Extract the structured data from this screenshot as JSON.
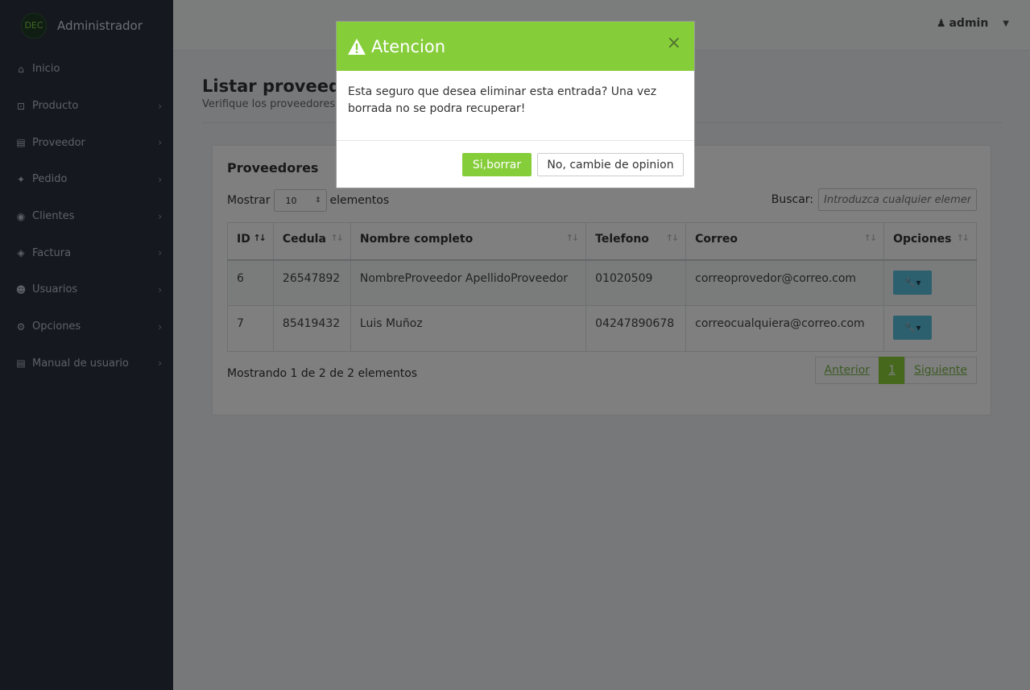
{
  "brand": {
    "logo_text": "DEC",
    "name": "Administrador"
  },
  "sidebar": {
    "items": [
      {
        "label": "Inicio",
        "icon": "home-icon",
        "glyph": "⌂"
      },
      {
        "label": "Producto",
        "icon": "basket-icon",
        "glyph": "⊡"
      },
      {
        "label": "Proveedor",
        "icon": "book-icon",
        "glyph": "▤"
      },
      {
        "label": "Pedido",
        "icon": "gift-icon",
        "glyph": "✦"
      },
      {
        "label": "Clientes",
        "icon": "handshake-icon",
        "glyph": "◉"
      },
      {
        "label": "Factura",
        "icon": "tag-icon",
        "glyph": "◈"
      },
      {
        "label": "Usuarios",
        "icon": "users-icon",
        "glyph": "☻"
      },
      {
        "label": "Opciones",
        "icon": "gear-icon",
        "glyph": "⚙"
      },
      {
        "label": "Manual de usuario",
        "icon": "book-icon",
        "glyph": "▤"
      }
    ],
    "chevron": "›"
  },
  "topbar": {
    "user": "admin",
    "caret": "▼",
    "user_glyph": "♟"
  },
  "page": {
    "title": "Listar proveedores",
    "subtitle": "Verifique los proveedores"
  },
  "card": {
    "title": "Proveedores",
    "length_prefix": "Mostrar",
    "length_value": "10",
    "length_suffix": "elementos",
    "search_label": "Buscar:",
    "search_placeholder": "Introduzca cualquier elemento",
    "columns": [
      "ID",
      "Cedula",
      "Nombre completo",
      "Telefono",
      "Correo",
      "Opciones"
    ],
    "rows": [
      {
        "id": "6",
        "cedula": "26547892",
        "nombre": "NombreProveedor ApellidoProveedor",
        "telefono": "01020509",
        "correo": "correoprovedor@correo.com"
      },
      {
        "id": "7",
        "cedula": "85419432",
        "nombre": "Luis Muñoz",
        "telefono": "04247890678",
        "correo": "correocualquiera@correo.com"
      }
    ],
    "info": "Mostrando 1 de 2 de 2 elementos",
    "pager": {
      "prev": "Anterior",
      "page": "1",
      "next": "Siguiente"
    }
  },
  "modal": {
    "title": "Atencion",
    "close": "×",
    "body": "Esta seguro que desea eliminar esta entrada? Una vez borrada no se podra recuperar!",
    "confirm": "Si,borrar",
    "cancel": "No, cambie de opinion"
  },
  "colors": {
    "accent": "#86cd3a",
    "sidebar": "#2a323f",
    "tool": "#5bc0de"
  }
}
